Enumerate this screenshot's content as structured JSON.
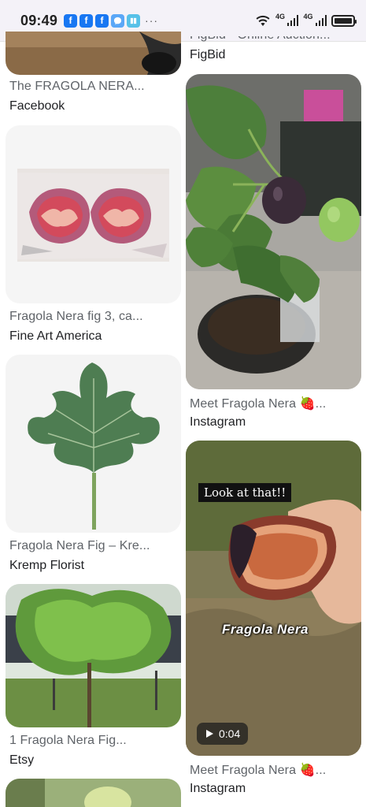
{
  "status_bar": {
    "time": "09:49",
    "notification_icons": [
      "facebook-icon",
      "facebook-icon",
      "facebook-icon",
      "messenger-icon",
      "book-reader-icon"
    ],
    "more": "···",
    "signal_1_label": "4G",
    "signal_2_label": "4G"
  },
  "results": [
    {
      "title": "The FRAGOLA NERA...",
      "source": "Facebook"
    },
    {
      "title": "Fragola Nera fig 3, ca...",
      "source": "Fine Art America"
    },
    {
      "title": "Fragola Nera Fig – Kre...",
      "source": "Kremp Florist"
    },
    {
      "title": "1 Fragola Nera Fig...",
      "source": "Etsy"
    },
    {
      "title": "FigBid - Online Auction...",
      "source": "FigBid"
    },
    {
      "title": "Meet Fragola Nera 🍓...",
      "source": "Instagram"
    },
    {
      "title": "Meet Fragola Nera 🍓...",
      "source": "Instagram",
      "overlay_text": "Look at that!!",
      "overlay_title": "Fragola Nera",
      "duration": "0:04"
    }
  ],
  "colors": {
    "status_bg": "#f4f2f8",
    "caption": "#5f6368",
    "source": "#202124"
  }
}
